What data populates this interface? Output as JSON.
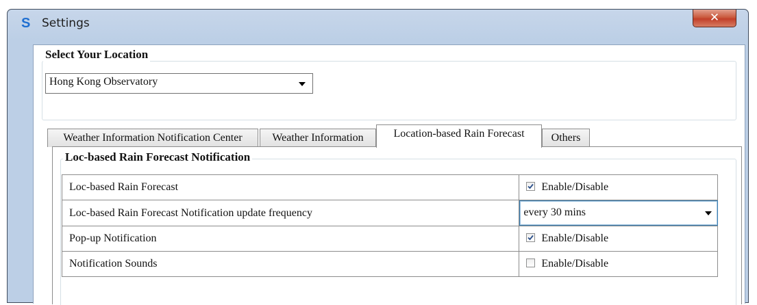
{
  "window": {
    "title": "Settings",
    "close_glyph": "✕",
    "app_icon": "S"
  },
  "location": {
    "group_title": "Select Your Location",
    "selected": "Hong Kong Observatory"
  },
  "tabs": [
    {
      "label": "Weather Information Notification Center",
      "active": false
    },
    {
      "label": "Weather Information",
      "active": false
    },
    {
      "label": "Location-based Rain Forecast",
      "active": true
    },
    {
      "label": "Others",
      "active": false
    }
  ],
  "rain_forecast": {
    "group_title": "Loc-based Rain Forecast Notification",
    "rows": [
      {
        "label": "Loc-based Rain Forecast",
        "control": "checkbox",
        "checked": true,
        "text": "Enable/Disable"
      },
      {
        "label": "Loc-based Rain Forecast Notification update frequency",
        "control": "dropdown",
        "value": "every 30 mins"
      },
      {
        "label": "Pop-up Notification",
        "control": "checkbox",
        "checked": true,
        "text": "Enable/Disable"
      },
      {
        "label": "Notification Sounds",
        "control": "checkbox",
        "checked": false,
        "text": "Enable/Disable"
      }
    ]
  },
  "colors": {
    "check": "#2a4f8a",
    "title_frame": "#bccfe6",
    "close_button": "#c2402a"
  }
}
